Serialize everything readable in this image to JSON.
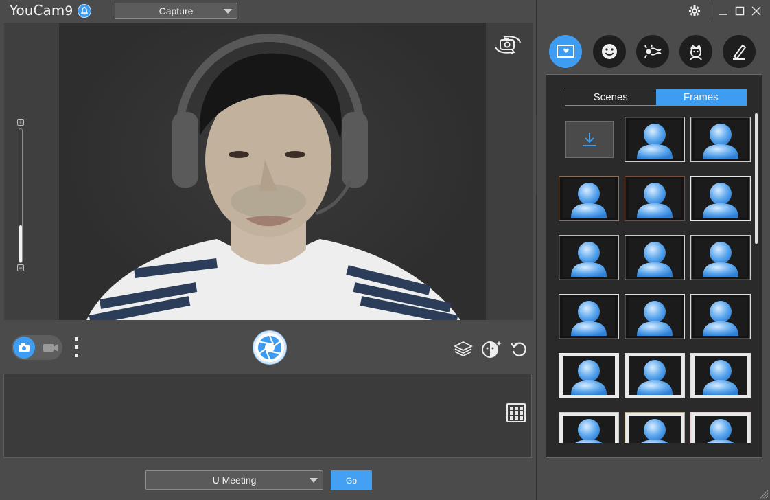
{
  "app": {
    "title": "YouCam",
    "version": "9"
  },
  "mode": {
    "selected": "Capture"
  },
  "zoom": {
    "plus": "+",
    "minus": "−",
    "level": 0.28
  },
  "meeting": {
    "selected": "U Meeting",
    "go_label": "Go"
  },
  "effects": {
    "tabs": [
      {
        "label": "Scenes",
        "selected": false
      },
      {
        "label": "Frames",
        "selected": true
      }
    ],
    "categories": [
      "scenes-frames",
      "emoji",
      "particles",
      "avatar",
      "brush"
    ]
  },
  "colors": {
    "accent": "#3f9df1",
    "panel": "#2a2a2a",
    "background": "#4b4b4b"
  }
}
